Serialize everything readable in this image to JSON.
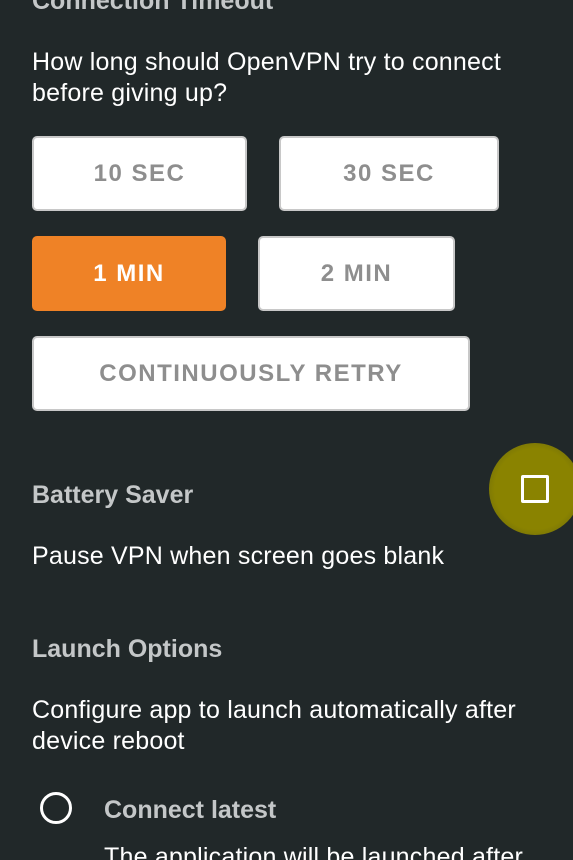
{
  "connection_timeout": {
    "title": "Connection Timeout",
    "description": "How long should OpenVPN try to connect before giving up?",
    "options": [
      {
        "label": "10 SEC",
        "selected": false
      },
      {
        "label": "30 SEC",
        "selected": false
      },
      {
        "label": "1 MIN",
        "selected": true
      },
      {
        "label": "2 MIN",
        "selected": false
      },
      {
        "label": "CONTINUOUSLY RETRY",
        "selected": false
      }
    ]
  },
  "battery_saver": {
    "title": "Battery Saver",
    "description": "Pause VPN when screen goes blank",
    "checked": false
  },
  "launch_options": {
    "title": "Launch Options",
    "description": "Configure app to launch automatically after device reboot",
    "radio_item": {
      "label": "Connect latest",
      "description": "The application will be launched after"
    }
  },
  "colors": {
    "background": "#212829",
    "accent": "#ef8226",
    "toggle_highlight": "#8a8300"
  }
}
